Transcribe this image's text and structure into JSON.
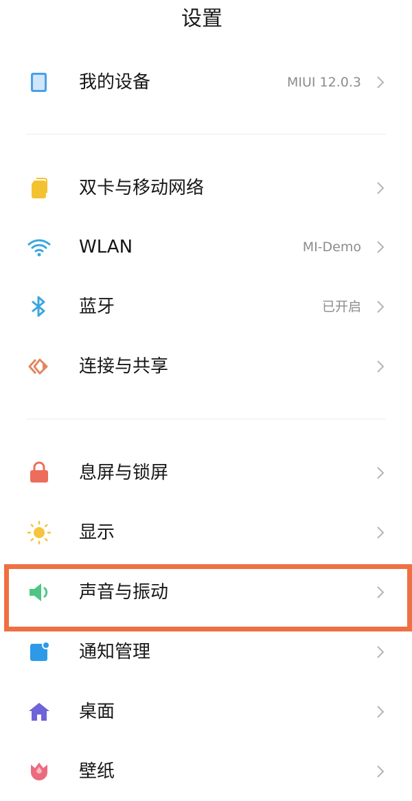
{
  "header": {
    "title": "设置"
  },
  "sections": [
    {
      "items": [
        {
          "label": "我的设备",
          "value": "MIUI 12.0.3",
          "icon": "tablet-device-icon",
          "icon_color": "#4a9fe8"
        }
      ]
    },
    {
      "items": [
        {
          "label": "双卡与移动网络",
          "value": "",
          "icon": "sim-card-icon",
          "icon_color": "#f3c230"
        },
        {
          "label": "WLAN",
          "value": "MI-Demo",
          "icon": "wifi-icon",
          "icon_color": "#3aa6e0"
        },
        {
          "label": "蓝牙",
          "value": "已开启",
          "icon": "bluetooth-icon",
          "icon_color": "#3aa6e0"
        },
        {
          "label": "连接与共享",
          "value": "",
          "icon": "connection-share-icon",
          "icon_color": "#e2855f"
        }
      ]
    },
    {
      "items": [
        {
          "label": "息屏与锁屏",
          "value": "",
          "icon": "lock-icon",
          "icon_color": "#ec6d5c"
        },
        {
          "label": "显示",
          "value": "",
          "icon": "sun-icon",
          "icon_color": "#f5c43c"
        },
        {
          "label": "声音与振动",
          "value": "",
          "icon": "speaker-icon",
          "icon_color": "#4ec583"
        },
        {
          "label": "通知管理",
          "value": "",
          "icon": "notification-icon",
          "icon_color": "#2c9ae8"
        },
        {
          "label": "桌面",
          "value": "",
          "icon": "home-icon",
          "icon_color": "#6e63d8"
        },
        {
          "label": "壁纸",
          "value": "",
          "icon": "tulip-icon",
          "icon_color": "#ec6a7e"
        }
      ]
    }
  ],
  "highlight": {
    "target": "声音与振动",
    "color": "#ee7043"
  }
}
